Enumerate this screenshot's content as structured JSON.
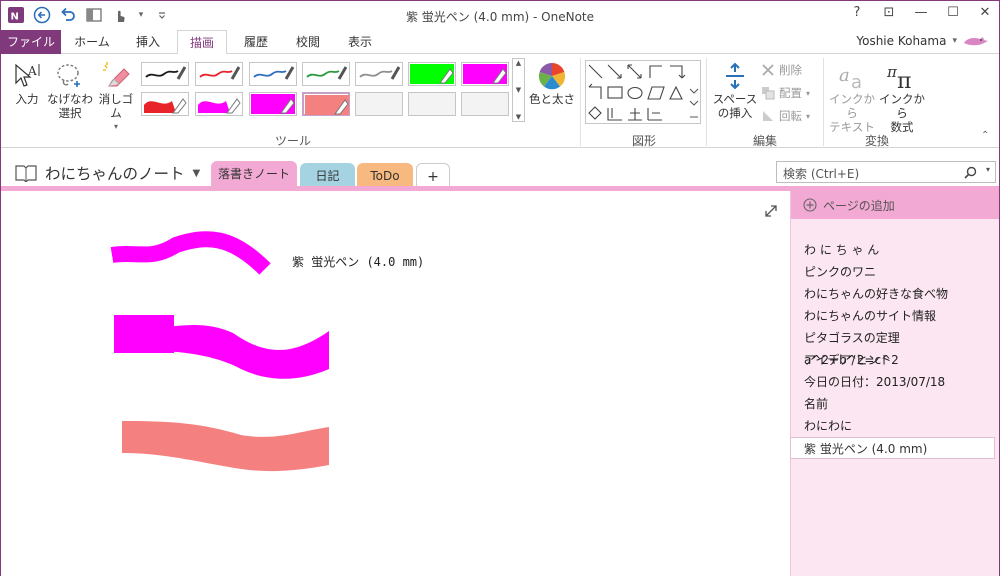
{
  "window": {
    "title": "紫 蛍光ペン (4.0 mm) - OneNote",
    "controls": {
      "help": "?",
      "restore_ribbon": "⊡",
      "minimize": "—",
      "maximize": "☐",
      "close": "✕"
    }
  },
  "quick_access": {
    "customize": "▾"
  },
  "tabs": [
    {
      "label": "ファイル"
    },
    {
      "label": "ホーム"
    },
    {
      "label": "挿入"
    },
    {
      "label": "描画"
    },
    {
      "label": "履歴"
    },
    {
      "label": "校閲"
    },
    {
      "label": "表示"
    }
  ],
  "user": {
    "name": "Yoshie Kohama",
    "dropdown": "▾"
  },
  "ribbon": {
    "tools": {
      "input": "入力",
      "lasso": [
        "なげなわ",
        "選択"
      ],
      "eraser": "消しゴム",
      "color_thickness": "色と太さ",
      "group_label": "ツール",
      "pen_colors": [
        "#1a1a1a",
        "#e8232a",
        "#2e6fc0",
        "#2a9a3e",
        "#8f8f8f",
        "#00ff00",
        "#ff00ff",
        "#e8232a",
        "#ff00ff",
        "#ff00ff",
        "#f58080"
      ]
    },
    "shapes": {
      "group_label": "図形"
    },
    "edit": {
      "space": [
        "スペース",
        "の挿入"
      ],
      "delete": "削除",
      "arrange": "配置",
      "rotate": "回転",
      "group_label": "編集"
    },
    "convert": {
      "ink_to_text": [
        "インクから",
        "テキスト"
      ],
      "ink_to_math": [
        "インクから",
        "数式"
      ],
      "group_label": "変換"
    }
  },
  "notebook": {
    "title": "わにちゃんのノート",
    "sections": [
      {
        "label": "落書きノート",
        "color": "#f2a9d3"
      },
      {
        "label": "日記",
        "color": "#a6d3e2"
      },
      {
        "label": "ToDo",
        "color": "#f7b97f"
      },
      {
        "label": "+",
        "color": "#ffffff"
      }
    ],
    "search_placeholder": "検索 (Ctrl+E)"
  },
  "page": {
    "label": "紫 蛍光ペン (4.0 mm)"
  },
  "page_list": {
    "add_page": "ページの追加",
    "pages": [
      "わ に ち ゃ ん",
      "ピンクのワニ",
      "わにちゃんの好きな食べ物",
      "わにちゃんのサイト情報",
      "ピタゴラスの定理　a^2+b^2=c^2",
      "アイデア/ヒント",
      "今日の日付：2013/07/18",
      "名前",
      "わにわに",
      "紫 蛍光ペン (4.0 mm)"
    ]
  }
}
